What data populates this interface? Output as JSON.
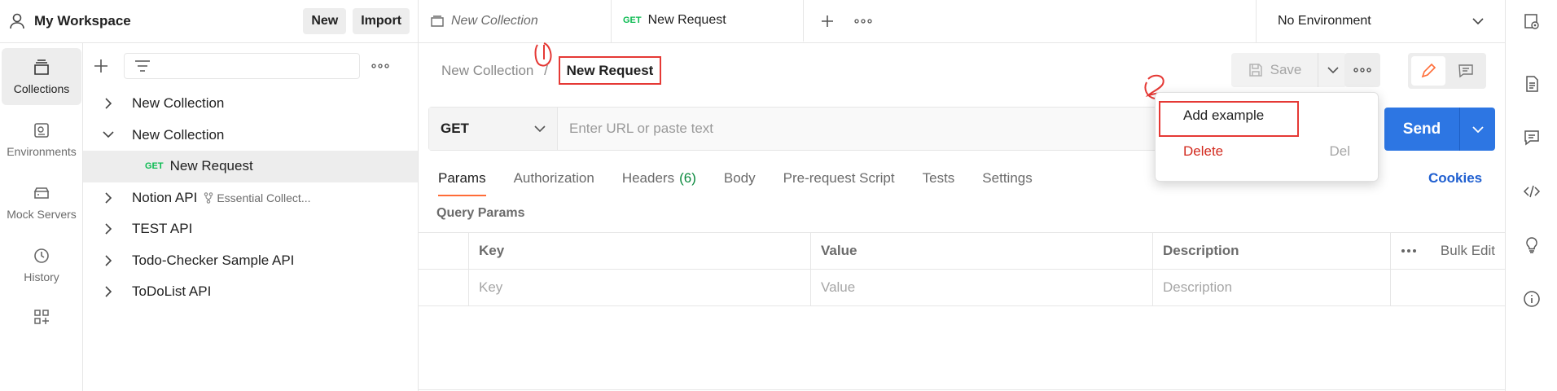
{
  "workspace": {
    "title": "My Workspace",
    "new_label": "New",
    "import_label": "Import"
  },
  "tabs": [
    {
      "label": "New Collection",
      "italic": true
    },
    {
      "method": "GET",
      "label": "New Request",
      "active": true
    }
  ],
  "environment": {
    "selected": "No Environment"
  },
  "rail": [
    {
      "label": "Collections",
      "icon": "collections-icon",
      "active": true
    },
    {
      "label": "Environments",
      "icon": "environments-icon"
    },
    {
      "label": "Mock Servers",
      "icon": "mock-servers-icon"
    },
    {
      "label": "History",
      "icon": "history-icon"
    }
  ],
  "sidebar": {
    "items": [
      {
        "label": "New Collection",
        "expanded": false
      },
      {
        "label": "New Collection",
        "expanded": true
      },
      {
        "method": "GET",
        "label": "New Request",
        "child": true,
        "selected": true
      },
      {
        "label": "Notion API",
        "sub": "Essential Collect..."
      },
      {
        "label": "TEST API"
      },
      {
        "label": "Todo-Checker Sample API"
      },
      {
        "label": "ToDoList API"
      }
    ]
  },
  "request": {
    "breadcrumb_parent": "New Collection",
    "breadcrumb_sep": "/",
    "breadcrumb_current": "New Request",
    "save_label": "Save",
    "method": "GET",
    "url_placeholder": "Enter URL or paste text",
    "send_label": "Send",
    "tabs": [
      "Params",
      "Authorization",
      "Headers",
      "Body",
      "Pre-request Script",
      "Tests",
      "Settings"
    ],
    "headers_count": "(6)",
    "cookies_label": "Cookies",
    "query_params_title": "Query Params",
    "table_headers": {
      "key": "Key",
      "value": "Value",
      "description": "Description",
      "bulk_edit": "Bulk Edit"
    },
    "table_placeholders": {
      "key": "Key",
      "value": "Value",
      "description": "Description"
    }
  },
  "menu": {
    "add_example": "Add example",
    "delete": "Delete",
    "delete_shortcut": "Del"
  },
  "colors": {
    "accent": "#ff6c37",
    "send": "#2d76e3",
    "annotation": "#e53935",
    "delete": "#d22a1e"
  }
}
